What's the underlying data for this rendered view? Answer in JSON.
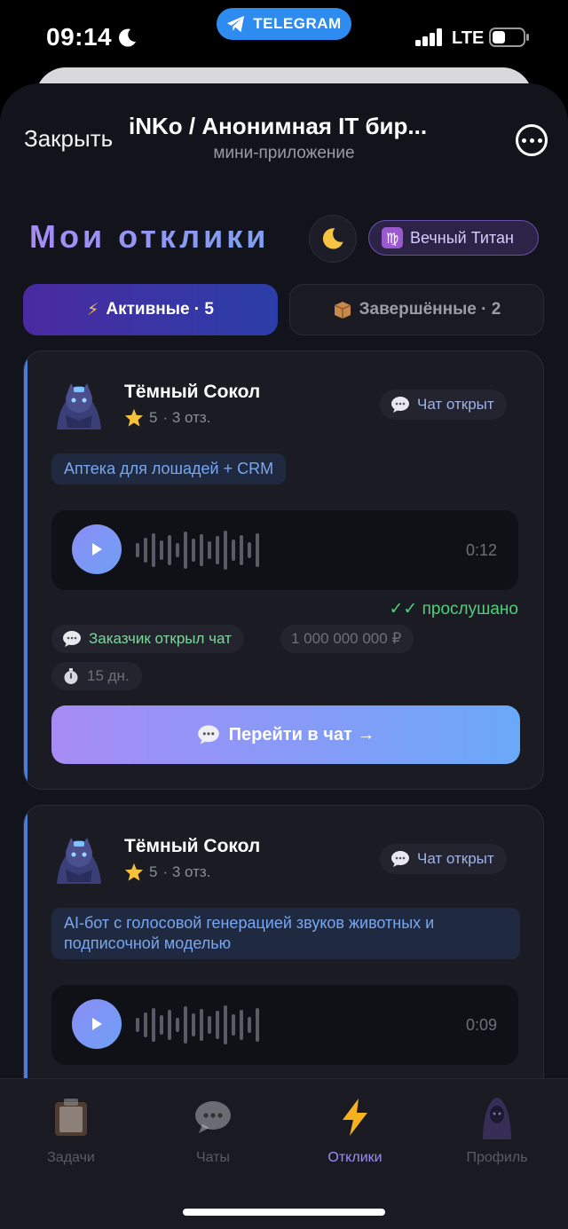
{
  "status_bar": {
    "time": "09:14",
    "carrier_pill": "TELEGRAM",
    "network": "LTE"
  },
  "header": {
    "close_label": "Закрыть",
    "title": "iNKo / Анонимная IT бир...",
    "subtitle": "мини-приложение"
  },
  "page": {
    "title": "Мои отклики",
    "theme_icon": "moon-icon",
    "rank_label": "Вечный Титан",
    "rank_symbol": "♍"
  },
  "tabs": [
    {
      "icon": "⚡",
      "label": "Активные · 5",
      "active": true
    },
    {
      "icon": "📦",
      "label": "Завершённые · 2",
      "active": false
    }
  ],
  "cards": [
    {
      "name": "Тёмный Сокол",
      "rating": "5",
      "reviews": "· 3 отз.",
      "chat_status": "Чат открыт",
      "tag": "Аптека для лошадей + CRM",
      "voice_duration": "0:12",
      "listened": "✓✓ прослушано",
      "chips": {
        "client_chat": "Заказчик открыл чат",
        "price": "1 000 000 000 ₽",
        "days": "15 дн."
      },
      "action": "Перейти в чат →"
    },
    {
      "name": "Тёмный Сокол",
      "rating": "5",
      "reviews": "· 3 отз.",
      "chat_status": "Чат открыт",
      "tag": "AI-бот с голосовой генерацией звуков животных и подписочной моделью",
      "voice_duration": "0:09"
    }
  ],
  "bottom_nav": [
    {
      "label": "Задачи",
      "icon": "clipboard-icon",
      "active": false
    },
    {
      "label": "Чаты",
      "icon": "speech-bubble-icon",
      "active": false
    },
    {
      "label": "Отклики",
      "icon": "lightning-icon",
      "active": true
    },
    {
      "label": "Профиль",
      "icon": "hooded-avatar-icon",
      "active": false
    }
  ],
  "colors": {
    "accent": "#9b8cf5",
    "background": "#13141b",
    "card": "#1a1b23",
    "success": "#4fcf7c",
    "link_blue": "#78a6f0"
  }
}
